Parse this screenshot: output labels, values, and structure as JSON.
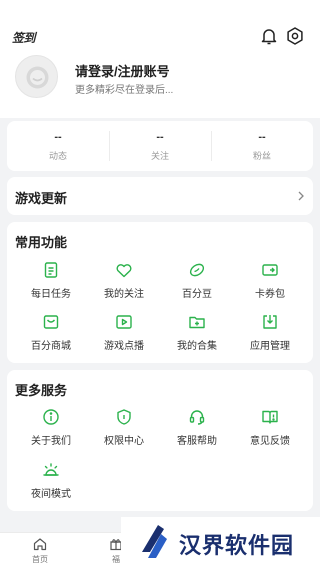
{
  "header": {
    "signin_label": "签到",
    "login_title": "请登录/注册账号",
    "login_subtitle": "更多精彩尽在登录后..."
  },
  "stats": [
    {
      "value": "--",
      "label": "动态"
    },
    {
      "value": "--",
      "label": "关注"
    },
    {
      "value": "--",
      "label": "粉丝"
    }
  ],
  "game_update": {
    "title": "游戏更新"
  },
  "common_functions": {
    "title": "常用功能",
    "items": [
      {
        "label": "每日任务",
        "icon": "task-icon"
      },
      {
        "label": "我的关注",
        "icon": "heart-icon"
      },
      {
        "label": "百分豆",
        "icon": "bean-icon"
      },
      {
        "label": "卡券包",
        "icon": "coupon-icon"
      },
      {
        "label": "百分商城",
        "icon": "mall-icon"
      },
      {
        "label": "游戏点播",
        "icon": "play-icon"
      },
      {
        "label": "我的合集",
        "icon": "folder-icon"
      },
      {
        "label": "应用管理",
        "icon": "download-icon"
      }
    ]
  },
  "more_services": {
    "title": "更多服务",
    "items": [
      {
        "label": "关于我们",
        "icon": "info-icon"
      },
      {
        "label": "权限中心",
        "icon": "shield-icon"
      },
      {
        "label": "客服帮助",
        "icon": "headset-icon"
      },
      {
        "label": "意见反馈",
        "icon": "feedback-icon"
      },
      {
        "label": "夜间模式",
        "icon": "night-icon"
      }
    ]
  },
  "tabbar": [
    {
      "label": "首页",
      "icon": "home-icon"
    },
    {
      "label": "福",
      "icon": "gift-icon"
    }
  ],
  "watermark": {
    "text": "汉界软件园"
  },
  "colors": {
    "accent": "#2bb24c",
    "background": "#f2f3f5",
    "watermark": "#1a2f6e"
  }
}
